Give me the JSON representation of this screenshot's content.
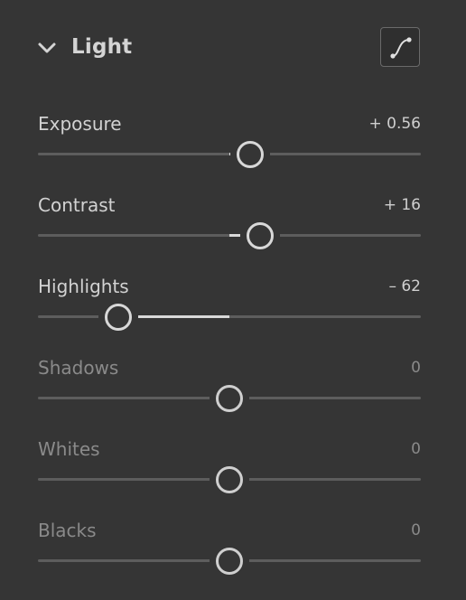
{
  "panel": {
    "title": "Light",
    "collapse_icon": "chevron-down-icon",
    "curve_button_icon": "tone-curve-icon"
  },
  "sliders": [
    {
      "key": "exposure",
      "label": "Exposure",
      "value_text": "+ 0.56",
      "position": 0.555,
      "fill_from": 0.5,
      "dim": false
    },
    {
      "key": "contrast",
      "label": "Contrast",
      "value_text": "+ 16",
      "position": 0.58,
      "fill_from": 0.5,
      "dim": false
    },
    {
      "key": "highlights",
      "label": "Highlights",
      "value_text": "– 62",
      "position": 0.21,
      "fill_from": 0.5,
      "dim": false
    },
    {
      "key": "shadows",
      "label": "Shadows",
      "value_text": "0",
      "position": 0.5,
      "fill_from": 0.5,
      "dim": true
    },
    {
      "key": "whites",
      "label": "Whites",
      "value_text": "0",
      "position": 0.5,
      "fill_from": 0.5,
      "dim": true
    },
    {
      "key": "blacks",
      "label": "Blacks",
      "value_text": "0",
      "position": 0.5,
      "fill_from": 0.5,
      "dim": true
    }
  ],
  "colors": {
    "background": "#353535",
    "track": "#5d5d5d",
    "fill": "#d9d9d9",
    "thumb_border": "#d8d8d8"
  }
}
